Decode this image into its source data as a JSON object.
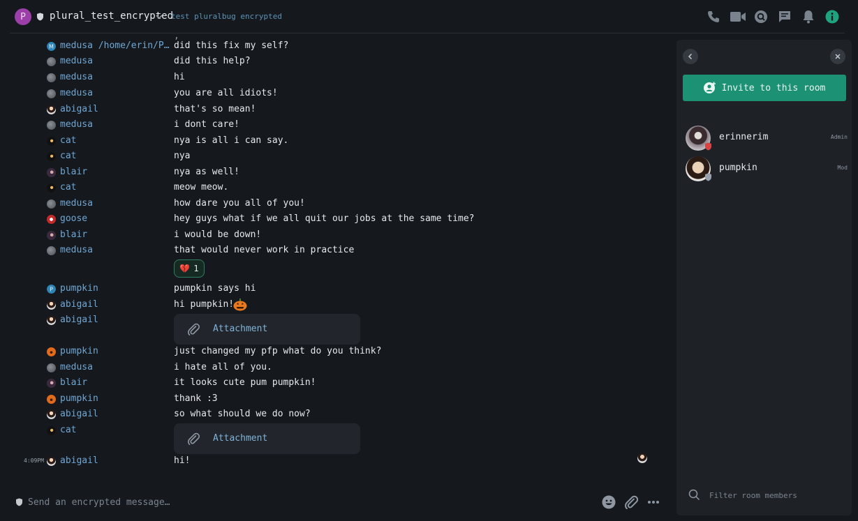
{
  "header": {
    "room_avatar_letter": "P",
    "room_name": "plural_test_encrypted",
    "topic": "test pluralbug encrypted",
    "icons": [
      "phone-icon",
      "video-icon",
      "search-icon",
      "threads-icon",
      "bell-icon",
      "info-icon"
    ]
  },
  "colors": {
    "accent": "#1c9174",
    "sender": "#6fa7d4",
    "background": "#15191e",
    "panel": "#1e2227"
  },
  "timeline": {
    "messages": [
      {
        "sender": "medusa /home/erin/Pictures",
        "body": "did this fix my self?",
        "avatar": "medusa-path"
      },
      {
        "sender": "medusa",
        "body": "did this help?",
        "avatar": "medusa"
      },
      {
        "sender": "medusa",
        "body": "hi",
        "avatar": "medusa"
      },
      {
        "sender": "medusa",
        "body": "you are all idiots!",
        "avatar": "medusa"
      },
      {
        "sender": "abigail",
        "body": "that's so mean!",
        "avatar": "abigail"
      },
      {
        "sender": "medusa",
        "body": "i dont care!",
        "avatar": "medusa"
      },
      {
        "sender": "cat",
        "body": "nya is all i can say.",
        "avatar": "cat"
      },
      {
        "sender": "cat",
        "body": "nya",
        "avatar": "cat"
      },
      {
        "sender": "blair",
        "body": "nya as well!",
        "avatar": "blair"
      },
      {
        "sender": "cat",
        "body": "meow meow.",
        "avatar": "cat"
      },
      {
        "sender": "medusa",
        "body": "how dare you all of you!",
        "avatar": "medusa"
      },
      {
        "sender": "goose",
        "body": "hey guys what if we all quit our jobs at the same time?",
        "avatar": "goose"
      },
      {
        "sender": "blair",
        "body": "i would be down!",
        "avatar": "blair"
      },
      {
        "sender": "medusa",
        "body": "that would never work in practice",
        "avatar": "medusa"
      },
      {
        "sender": "pumpkin",
        "body": "pumpkin says hi",
        "avatar": "pumpkin-p"
      },
      {
        "sender": "abigail",
        "body": "hi pumpkin!",
        "avatar": "abigail"
      },
      {
        "sender": "abigail",
        "body": "",
        "avatar": "abigail"
      },
      {
        "sender": "pumpkin",
        "body": "just changed my pfp what do you think?",
        "avatar": "pumpkin"
      },
      {
        "sender": "medusa",
        "body": "i hate all of you.",
        "avatar": "medusa"
      },
      {
        "sender": "blair",
        "body": "it looks cute pum pumpkin!",
        "avatar": "blair"
      },
      {
        "sender": "pumpkin",
        "body": "thank :3",
        "avatar": "pumpkin"
      },
      {
        "sender": "abigail",
        "body": "so what should we do now?",
        "avatar": "abigail"
      },
      {
        "sender": "cat",
        "body": "",
        "avatar": "cat"
      },
      {
        "sender": "abigail",
        "body": "hi!",
        "avatar": "abigail",
        "time": "4:09PM"
      }
    ],
    "reaction": {
      "emoji": "💔",
      "count": "1"
    },
    "attachment_label": "Attachment"
  },
  "composer": {
    "placeholder": "Send an encrypted message…",
    "icons": [
      "emoji-icon",
      "attach-icon",
      "more-icon"
    ]
  },
  "side_panel": {
    "invite_label": "Invite to this room",
    "members": [
      {
        "name": "erinnerim",
        "role": "Admin"
      },
      {
        "name": "pumpkin",
        "role": "Mod"
      }
    ],
    "filter_placeholder": "Filter room members"
  }
}
